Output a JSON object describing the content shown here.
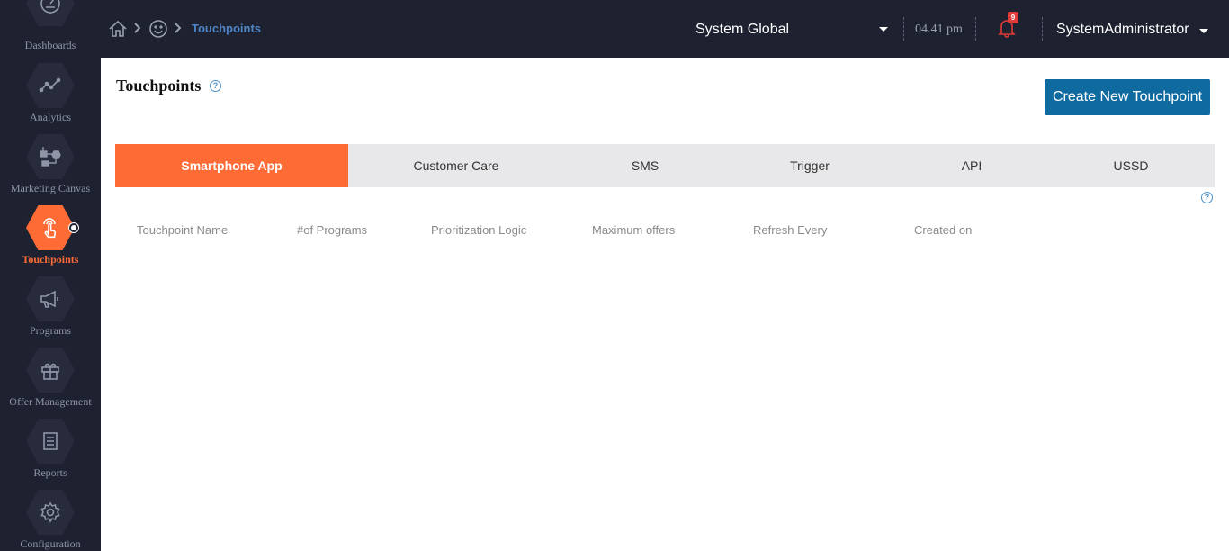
{
  "sidebar": {
    "items": [
      {
        "label": "Dashboards",
        "icon": "speedometer-icon"
      },
      {
        "label": "Analytics",
        "icon": "line-chart-icon"
      },
      {
        "label": "Marketing Canvas",
        "icon": "flow-diagram-icon"
      },
      {
        "label": "Touchpoints",
        "icon": "tap-hand-icon",
        "active": true
      },
      {
        "label": "Programs",
        "icon": "megaphone-icon"
      },
      {
        "label": "Offer Management",
        "icon": "gift-icon"
      },
      {
        "label": "Reports",
        "icon": "document-icon"
      },
      {
        "label": "Configuration",
        "icon": "gear-icon"
      }
    ]
  },
  "breadcrumb": {
    "current": "Touchpoints"
  },
  "header": {
    "org_select": "System Global",
    "time": "04.41 pm",
    "notification_count": "9",
    "user_name": "SystemAdministrator"
  },
  "page": {
    "title": "Touchpoints",
    "help": "?",
    "create_button": "Create New Touchpoint"
  },
  "tabs": [
    {
      "label": "Smartphone App",
      "active": true
    },
    {
      "label": "Customer Care"
    },
    {
      "label": "SMS"
    },
    {
      "label": "Trigger"
    },
    {
      "label": "API"
    },
    {
      "label": "USSD"
    }
  ],
  "table": {
    "columns": [
      "Touchpoint Name",
      "#of Programs",
      "Prioritization Logic",
      "Maximum offers",
      "Refresh Every",
      "Created on"
    ]
  },
  "colors": {
    "accent": "#fe6b35",
    "sidebar_bg": "#1e2130",
    "primary_button": "#0f6aa0",
    "breadcrumb_link": "#4f86c6"
  }
}
